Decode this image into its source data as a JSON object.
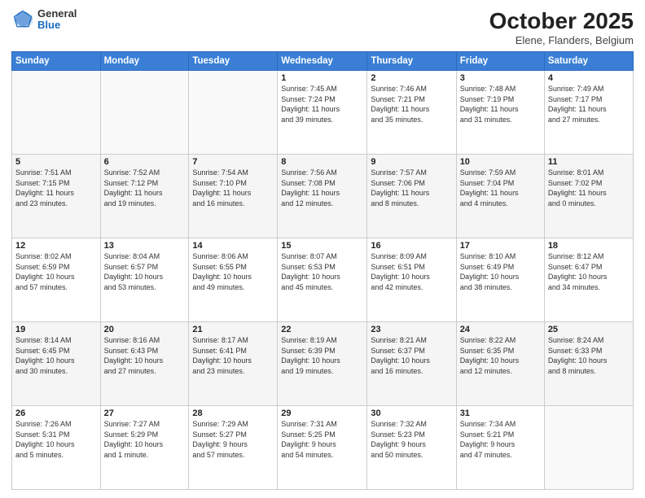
{
  "header": {
    "logo_general": "General",
    "logo_blue": "Blue",
    "main_title": "October 2025",
    "subtitle": "Elene, Flanders, Belgium"
  },
  "weekdays": [
    "Sunday",
    "Monday",
    "Tuesday",
    "Wednesday",
    "Thursday",
    "Friday",
    "Saturday"
  ],
  "weeks": [
    [
      {
        "day": "",
        "info": ""
      },
      {
        "day": "",
        "info": ""
      },
      {
        "day": "",
        "info": ""
      },
      {
        "day": "1",
        "info": "Sunrise: 7:45 AM\nSunset: 7:24 PM\nDaylight: 11 hours\nand 39 minutes."
      },
      {
        "day": "2",
        "info": "Sunrise: 7:46 AM\nSunset: 7:21 PM\nDaylight: 11 hours\nand 35 minutes."
      },
      {
        "day": "3",
        "info": "Sunrise: 7:48 AM\nSunset: 7:19 PM\nDaylight: 11 hours\nand 31 minutes."
      },
      {
        "day": "4",
        "info": "Sunrise: 7:49 AM\nSunset: 7:17 PM\nDaylight: 11 hours\nand 27 minutes."
      }
    ],
    [
      {
        "day": "5",
        "info": "Sunrise: 7:51 AM\nSunset: 7:15 PM\nDaylight: 11 hours\nand 23 minutes."
      },
      {
        "day": "6",
        "info": "Sunrise: 7:52 AM\nSunset: 7:12 PM\nDaylight: 11 hours\nand 19 minutes."
      },
      {
        "day": "7",
        "info": "Sunrise: 7:54 AM\nSunset: 7:10 PM\nDaylight: 11 hours\nand 16 minutes."
      },
      {
        "day": "8",
        "info": "Sunrise: 7:56 AM\nSunset: 7:08 PM\nDaylight: 11 hours\nand 12 minutes."
      },
      {
        "day": "9",
        "info": "Sunrise: 7:57 AM\nSunset: 7:06 PM\nDaylight: 11 hours\nand 8 minutes."
      },
      {
        "day": "10",
        "info": "Sunrise: 7:59 AM\nSunset: 7:04 PM\nDaylight: 11 hours\nand 4 minutes."
      },
      {
        "day": "11",
        "info": "Sunrise: 8:01 AM\nSunset: 7:02 PM\nDaylight: 11 hours\nand 0 minutes."
      }
    ],
    [
      {
        "day": "12",
        "info": "Sunrise: 8:02 AM\nSunset: 6:59 PM\nDaylight: 10 hours\nand 57 minutes."
      },
      {
        "day": "13",
        "info": "Sunrise: 8:04 AM\nSunset: 6:57 PM\nDaylight: 10 hours\nand 53 minutes."
      },
      {
        "day": "14",
        "info": "Sunrise: 8:06 AM\nSunset: 6:55 PM\nDaylight: 10 hours\nand 49 minutes."
      },
      {
        "day": "15",
        "info": "Sunrise: 8:07 AM\nSunset: 6:53 PM\nDaylight: 10 hours\nand 45 minutes."
      },
      {
        "day": "16",
        "info": "Sunrise: 8:09 AM\nSunset: 6:51 PM\nDaylight: 10 hours\nand 42 minutes."
      },
      {
        "day": "17",
        "info": "Sunrise: 8:10 AM\nSunset: 6:49 PM\nDaylight: 10 hours\nand 38 minutes."
      },
      {
        "day": "18",
        "info": "Sunrise: 8:12 AM\nSunset: 6:47 PM\nDaylight: 10 hours\nand 34 minutes."
      }
    ],
    [
      {
        "day": "19",
        "info": "Sunrise: 8:14 AM\nSunset: 6:45 PM\nDaylight: 10 hours\nand 30 minutes."
      },
      {
        "day": "20",
        "info": "Sunrise: 8:16 AM\nSunset: 6:43 PM\nDaylight: 10 hours\nand 27 minutes."
      },
      {
        "day": "21",
        "info": "Sunrise: 8:17 AM\nSunset: 6:41 PM\nDaylight: 10 hours\nand 23 minutes."
      },
      {
        "day": "22",
        "info": "Sunrise: 8:19 AM\nSunset: 6:39 PM\nDaylight: 10 hours\nand 19 minutes."
      },
      {
        "day": "23",
        "info": "Sunrise: 8:21 AM\nSunset: 6:37 PM\nDaylight: 10 hours\nand 16 minutes."
      },
      {
        "day": "24",
        "info": "Sunrise: 8:22 AM\nSunset: 6:35 PM\nDaylight: 10 hours\nand 12 minutes."
      },
      {
        "day": "25",
        "info": "Sunrise: 8:24 AM\nSunset: 6:33 PM\nDaylight: 10 hours\nand 8 minutes."
      }
    ],
    [
      {
        "day": "26",
        "info": "Sunrise: 7:26 AM\nSunset: 5:31 PM\nDaylight: 10 hours\nand 5 minutes."
      },
      {
        "day": "27",
        "info": "Sunrise: 7:27 AM\nSunset: 5:29 PM\nDaylight: 10 hours\nand 1 minute."
      },
      {
        "day": "28",
        "info": "Sunrise: 7:29 AM\nSunset: 5:27 PM\nDaylight: 9 hours\nand 57 minutes."
      },
      {
        "day": "29",
        "info": "Sunrise: 7:31 AM\nSunset: 5:25 PM\nDaylight: 9 hours\nand 54 minutes."
      },
      {
        "day": "30",
        "info": "Sunrise: 7:32 AM\nSunset: 5:23 PM\nDaylight: 9 hours\nand 50 minutes."
      },
      {
        "day": "31",
        "info": "Sunrise: 7:34 AM\nSunset: 5:21 PM\nDaylight: 9 hours\nand 47 minutes."
      },
      {
        "day": "",
        "info": ""
      }
    ]
  ]
}
